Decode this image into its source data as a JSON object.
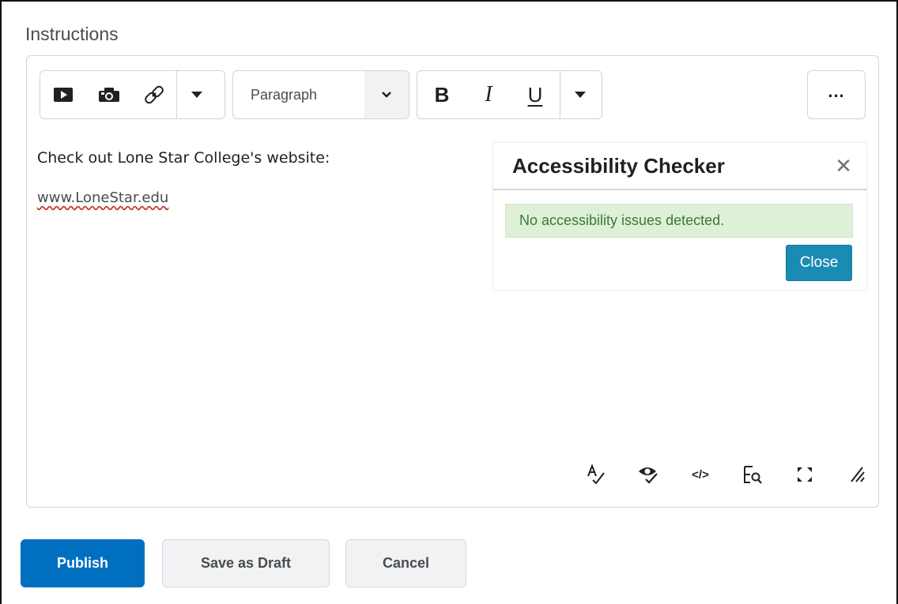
{
  "section": {
    "title": "Instructions"
  },
  "toolbar": {
    "icons": [
      "video-icon",
      "camera-icon",
      "link-icon",
      "dropdown-arrow-icon"
    ],
    "format_select": "Paragraph",
    "bold_label": "B",
    "italic_label": "I",
    "underline_label": "U",
    "more_label": "..."
  },
  "content": {
    "line1": "Check out Lone Star College's website:",
    "link_text": "www.LoneStar.edu"
  },
  "accessibility_panel": {
    "title": "Accessibility Checker",
    "close_x": "✕",
    "message": "No accessibility issues detected.",
    "close_button": "Close",
    "colors": {
      "message_bg": "#dff0d8",
      "message_text": "#3c763d",
      "button_bg": "#1a8bb3"
    }
  },
  "bottom_tools": {
    "icons": [
      "spellcheck-icon",
      "accessibility-check-icon",
      "source-code-icon",
      "find-replace-icon",
      "fullscreen-icon",
      "resize-handle-icon"
    ],
    "source_code_label": "</>"
  },
  "actions": {
    "publish": "Publish",
    "save_draft": "Save as Draft",
    "cancel": "Cancel"
  },
  "colors": {
    "primary": "#006fbf",
    "border": "#cdd5dc"
  }
}
